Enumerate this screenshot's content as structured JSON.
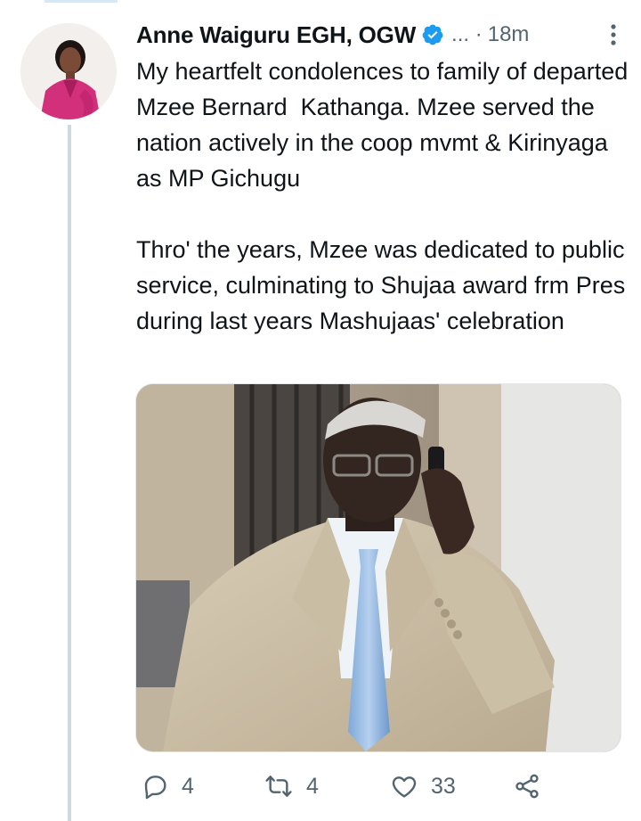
{
  "tweet": {
    "author_name": "Anne Waiguru EGH, OGW",
    "separator": "... ·",
    "time": "18m",
    "paragraphs": [
      "My heartfelt condolences to family of departed Mzee Bernard  Kathanga. Mzee served the nation actively in the coop mvmt & Kirinyaga as MP Gichugu",
      "Thro' the years, Mzee was dedicated to public service, culminating to Shujaa award frm Pres during last years Mashujaas' celebration"
    ]
  },
  "actions": {
    "reply_count": "4",
    "retweet_count": "4",
    "like_count": "33"
  },
  "colors": {
    "verified": "#1d9bf0",
    "meta_text": "#536471",
    "thread_line": "#cfd9de"
  },
  "icons": [
    "verified-badge-icon",
    "more-options-icon",
    "reply-icon",
    "retweet-icon",
    "like-icon",
    "share-icon"
  ]
}
